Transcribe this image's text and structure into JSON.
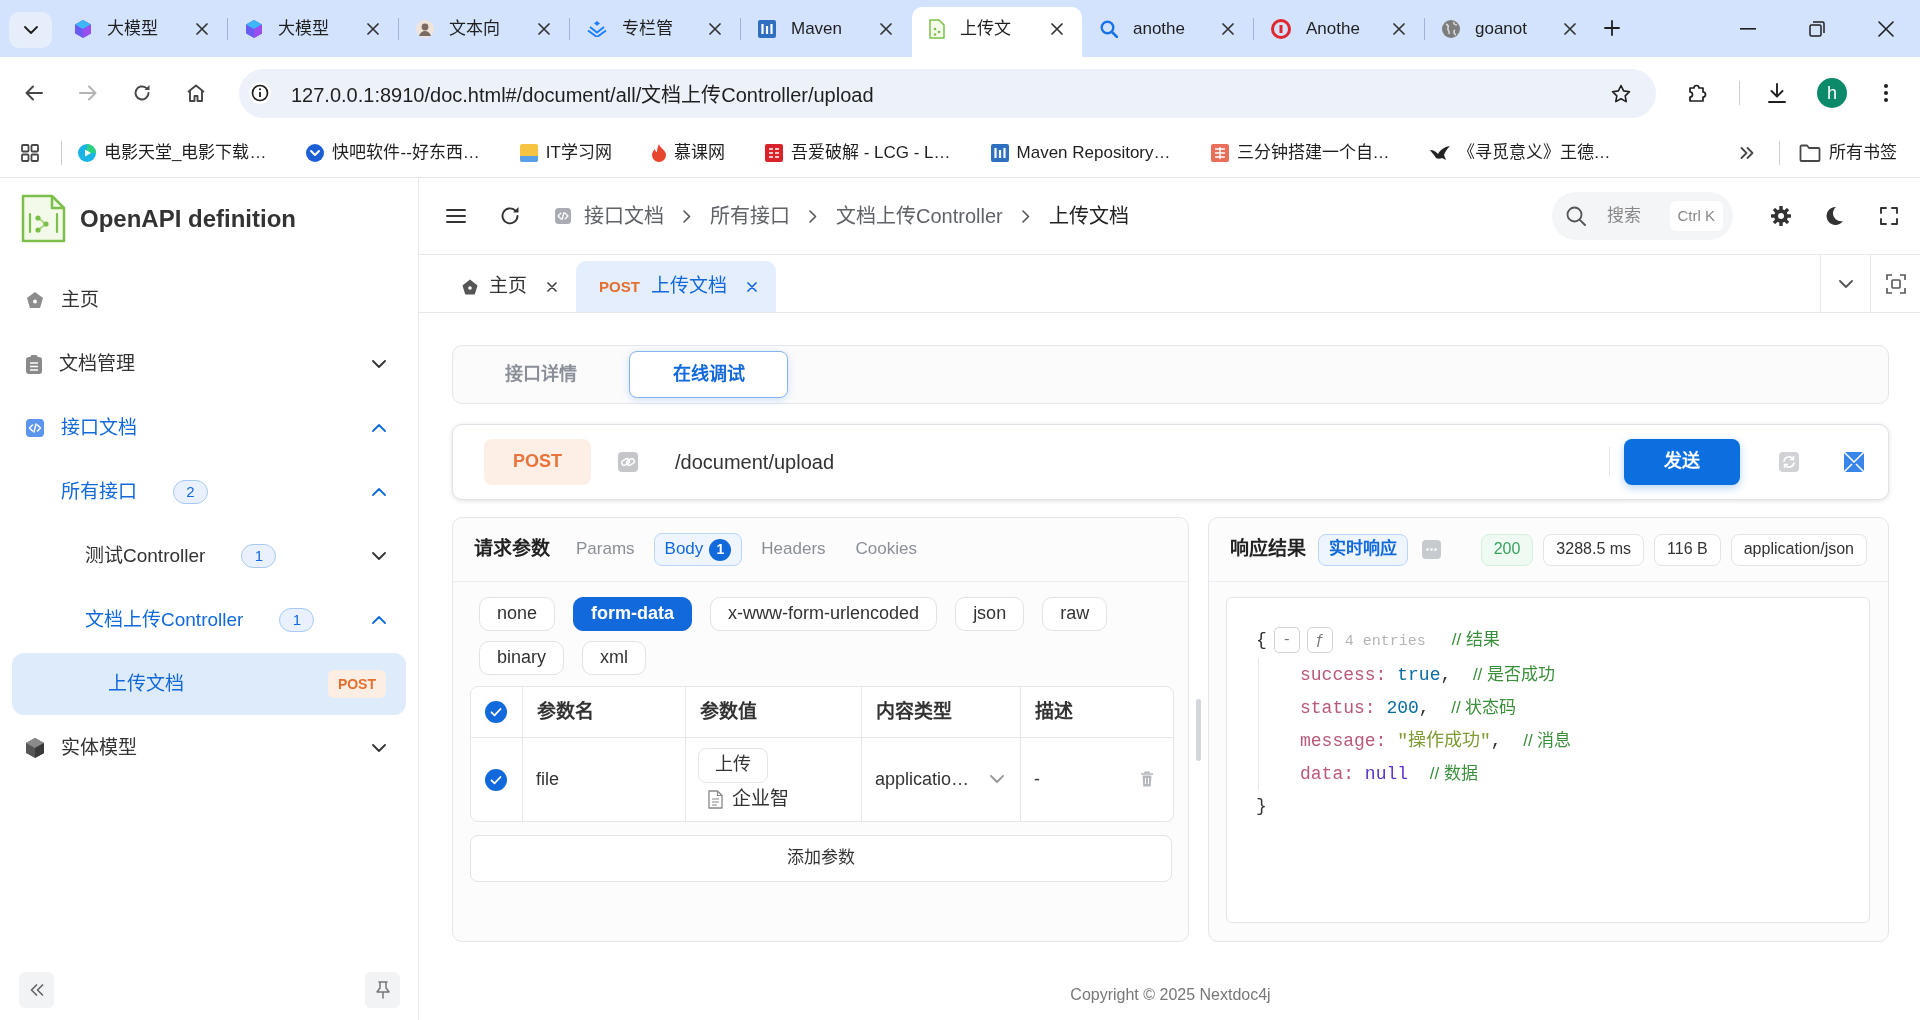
{
  "browser": {
    "tabs": [
      {
        "title": "大模型",
        "selected": false
      },
      {
        "title": "大模型",
        "selected": false
      },
      {
        "title": "文本向",
        "selected": false
      },
      {
        "title": "专栏管",
        "selected": false
      },
      {
        "title": "Maven",
        "selected": false
      },
      {
        "title": "上传文",
        "selected": true
      },
      {
        "title": "anothe",
        "selected": false
      },
      {
        "title": "Anothe",
        "selected": false
      },
      {
        "title": "goanot",
        "selected": false
      }
    ],
    "forward_disabled": true,
    "url": "127.0.0.1:8910/doc.html#/document/all/文档上传Controller/upload",
    "profile_initial": "h",
    "bookmarks": [
      "电影天堂_电影下载…",
      "快吧软件--好东西…",
      "IT学习网",
      "慕课网",
      "吾爱破解 - LCG - L…",
      "Maven Repository…",
      "三分钟搭建一个自…",
      "《寻觅意义》王德…"
    ],
    "all_bookmarks": "所有书签"
  },
  "sidebar": {
    "title": "OpenAPI definition",
    "items": [
      {
        "kind": "page",
        "label": "主页",
        "selected": false
      },
      {
        "kind": "group",
        "label": "文档管理",
        "expanded": false,
        "selected": false
      },
      {
        "kind": "group",
        "label": "接口文档",
        "expanded": true,
        "selected": false,
        "children": [
          {
            "kind": "group",
            "label": "所有接口",
            "count": "2",
            "expanded": true,
            "selected": false,
            "children": [
              {
                "kind": "group",
                "label": "测试Controller",
                "count": "1",
                "expanded": false,
                "selected": false
              },
              {
                "kind": "group",
                "label": "文档上传Controller",
                "count": "1",
                "expanded": true,
                "selected": false,
                "children": [
                  {
                    "kind": "endpoint",
                    "label": "上传文档",
                    "method": "POST",
                    "selected": true
                  }
                ]
              }
            ]
          }
        ]
      },
      {
        "kind": "group",
        "label": "实体模型",
        "expanded": false,
        "selected": false
      }
    ]
  },
  "header": {
    "breadcrumb": [
      "接口文档",
      "所有接口",
      "文档上传Controller",
      "上传文档"
    ],
    "search": {
      "placeholder": "搜索",
      "shortcut": "Ctrl K"
    }
  },
  "page_tabs": [
    {
      "kind": "home",
      "label": "主页",
      "selected": false
    },
    {
      "kind": "endpoint",
      "method": "POST",
      "label": "上传文档",
      "selected": true
    }
  ],
  "view_tabs": [
    {
      "label": "接口详情",
      "selected": false
    },
    {
      "label": "在线调试",
      "selected": true
    }
  ],
  "request_line": {
    "method": "POST",
    "path": "/document/upload",
    "send": "发送"
  },
  "request": {
    "title": "请求参数",
    "tabs": [
      {
        "label": "Params",
        "selected": false
      },
      {
        "label": "Body",
        "count": "1",
        "selected": true
      },
      {
        "label": "Headers",
        "selected": false
      },
      {
        "label": "Cookies",
        "selected": false
      }
    ],
    "body_types": [
      {
        "label": "none",
        "selected": false
      },
      {
        "label": "form-data",
        "selected": true
      },
      {
        "label": "x-www-form-urlencoded",
        "selected": false
      },
      {
        "label": "json",
        "selected": false
      },
      {
        "label": "raw",
        "selected": false
      },
      {
        "label": "binary",
        "selected": false
      },
      {
        "label": "xml",
        "selected": false
      }
    ],
    "table": {
      "all_checked": true,
      "columns": [
        "参数名",
        "参数值",
        "内容类型",
        "描述"
      ],
      "rows": [
        {
          "checked": true,
          "name": "file",
          "upload": "上传",
          "file": "企业智",
          "content_type": "applicatio…",
          "description": "-"
        }
      ]
    },
    "add_button": "添加参数"
  },
  "response": {
    "title": "响应结果",
    "mode": "实时响应",
    "badges": [
      {
        "kind": "status",
        "text": "200"
      },
      {
        "kind": "info",
        "text": "3288.5 ms"
      },
      {
        "kind": "info",
        "text": "116 B"
      },
      {
        "kind": "info",
        "text": "application/json"
      }
    ],
    "body": {
      "open": "{",
      "collapse": "-",
      "format": "ƒ",
      "entries": "4 entries",
      "comment": "// 结果",
      "fields": [
        {
          "key": "success:",
          "value": "true",
          "kind": "boolean",
          "separator": ",",
          "comment": "// 是否成功"
        },
        {
          "key": "status:",
          "value": "200",
          "kind": "number",
          "separator": ",",
          "comment": "// 状态码"
        },
        {
          "key": "message:",
          "value": "\"操作成功\"",
          "kind": "string",
          "separator": ",",
          "comment": "// 消息"
        },
        {
          "key": "data:",
          "value": "null",
          "kind": "null",
          "comment": "// 数据"
        }
      ],
      "close": "}"
    }
  },
  "footer": "Copyright © 2025 Nextdoc4j"
}
